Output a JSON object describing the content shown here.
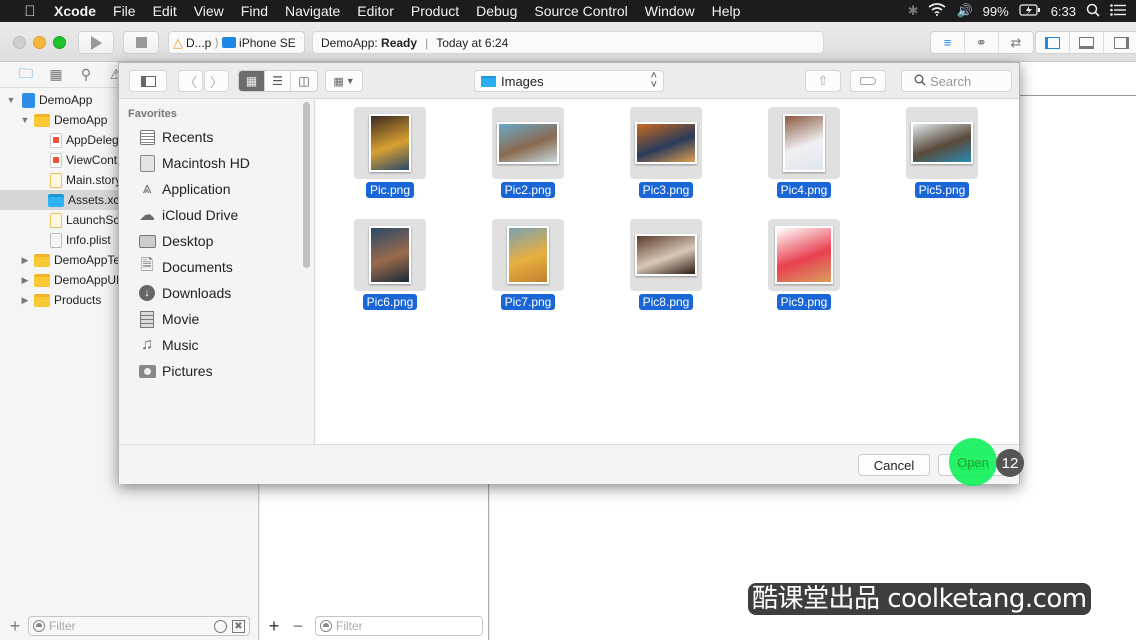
{
  "menubar": {
    "app_name": "Xcode",
    "items": [
      "File",
      "Edit",
      "View",
      "Find",
      "Navigate",
      "Editor",
      "Product",
      "Debug",
      "Source Control",
      "Window",
      "Help"
    ],
    "status": {
      "battery": "99%",
      "time": "6:33"
    }
  },
  "toolbar": {
    "scheme": "D...p",
    "device": "iPhone SE",
    "status_project": "DemoApp:",
    "status_state": "Ready",
    "status_time": "Today at 6:24"
  },
  "navigator": {
    "tree": [
      {
        "label": "DemoApp",
        "type": "project",
        "level": 0,
        "disclosure": "open"
      },
      {
        "label": "DemoApp",
        "type": "folder",
        "level": 1,
        "disclosure": "open"
      },
      {
        "label": "AppDelegate",
        "type": "swift",
        "level": 2
      },
      {
        "label": "ViewController",
        "type": "swift",
        "level": 2
      },
      {
        "label": "Main.storyboard",
        "type": "storyboard",
        "level": 2
      },
      {
        "label": "Assets.xcassets",
        "type": "assets",
        "level": 2,
        "selected": true
      },
      {
        "label": "LaunchScreen",
        "type": "storyboard",
        "level": 2
      },
      {
        "label": "Info.plist",
        "type": "plist",
        "level": 2
      },
      {
        "label": "DemoAppTests",
        "type": "folder",
        "level": 1,
        "disclosure": "closed"
      },
      {
        "label": "DemoAppUITests",
        "type": "folder",
        "level": 1,
        "disclosure": "closed"
      },
      {
        "label": "Products",
        "type": "folder",
        "level": 1,
        "disclosure": "closed"
      }
    ],
    "filter_placeholder": "Filter"
  },
  "asset_list": {
    "filter_placeholder": "Filter"
  },
  "open_dialog": {
    "location": "Images",
    "search_placeholder": "Search",
    "sidebar_header": "Favorites",
    "sidebar_items": [
      {
        "label": "Recents",
        "icon": "recents-icon"
      },
      {
        "label": "Macintosh HD",
        "icon": "hard-drive-icon"
      },
      {
        "label": "Application",
        "icon": "applications-icon"
      },
      {
        "label": "iCloud Drive",
        "icon": "cloud-icon"
      },
      {
        "label": "Desktop",
        "icon": "desktop-icon"
      },
      {
        "label": "Documents",
        "icon": "documents-icon"
      },
      {
        "label": "Downloads",
        "icon": "downloads-icon"
      },
      {
        "label": "Movie",
        "icon": "movie-icon"
      },
      {
        "label": "Music",
        "icon": "music-icon"
      },
      {
        "label": "Pictures",
        "icon": "camera-icon"
      }
    ],
    "files": [
      {
        "name": "Pic.png",
        "selected": true,
        "orientation": "portrait",
        "colors": [
          "#3a2a22",
          "#d8a030",
          "#2a4a6a"
        ]
      },
      {
        "name": "Pic2.png",
        "selected": true,
        "orientation": "landscape",
        "colors": [
          "#6aa8c8",
          "#8a6a50",
          "#c8d8e0"
        ]
      },
      {
        "name": "Pic3.png",
        "selected": true,
        "orientation": "landscape",
        "colors": [
          "#c86a20",
          "#2a3a5a",
          "#e0a050"
        ]
      },
      {
        "name": "Pic4.png",
        "selected": true,
        "orientation": "portrait",
        "colors": [
          "#8a5a40",
          "#f0f0f4",
          "#e0e6ee"
        ]
      },
      {
        "name": "Pic5.png",
        "selected": true,
        "orientation": "landscape",
        "colors": [
          "#e0e8ee",
          "#5a4a3a",
          "#2a8ab0"
        ]
      },
      {
        "name": "Pic6.png",
        "selected": true,
        "orientation": "portrait",
        "colors": [
          "#2a4a6a",
          "#9a6a4a",
          "#1a2a3a"
        ]
      },
      {
        "name": "Pic7.png",
        "selected": true,
        "orientation": "portrait",
        "colors": [
          "#7aa0b0",
          "#e8b040",
          "#c08030"
        ]
      },
      {
        "name": "Pic8.png",
        "selected": true,
        "orientation": "landscape",
        "colors": [
          "#5a3a2a",
          "#d8c8b8",
          "#2a1a10"
        ]
      },
      {
        "name": "Pic9.png",
        "selected": true,
        "orientation": "square",
        "colors": [
          "#ffffff",
          "#e84050",
          "#d8a060"
        ]
      }
    ],
    "cancel_label": "Cancel",
    "open_label": "Open"
  },
  "overlay": {
    "step_number": "12",
    "watermark": "酷课堂出品 coolketang.com"
  }
}
